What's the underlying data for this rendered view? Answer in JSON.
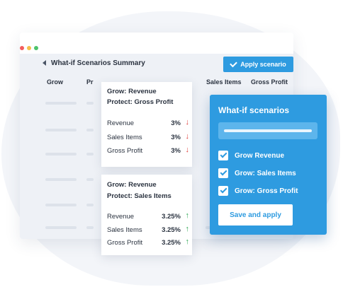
{
  "window": {
    "title": "What-if Scenarios Summary",
    "apply_button": "Apply scenario"
  },
  "table": {
    "columns": [
      "Grow",
      "Pr",
      "Sales Items",
      "Gross Profit"
    ]
  },
  "cards": [
    {
      "grow": "Grow: Revenue",
      "protect": "Protect: Gross Profit",
      "rows": [
        {
          "label": "Revenue",
          "value": "3%",
          "direction": "down"
        },
        {
          "label": "Sales Items",
          "value": "3%",
          "direction": "down"
        },
        {
          "label": "Gross Profit",
          "value": "3%",
          "direction": "down"
        }
      ]
    },
    {
      "grow": "Grow: Revenue",
      "protect": "Protect: Sales Items",
      "rows": [
        {
          "label": "Revenue",
          "value": "3.25%",
          "direction": "up"
        },
        {
          "label": "Sales Items",
          "value": "3.25%",
          "direction": "up"
        },
        {
          "label": "Gross Profit",
          "value": "3.25%",
          "direction": "up"
        }
      ]
    }
  ],
  "arrows": {
    "down": "↓",
    "up": "↑"
  },
  "panel": {
    "title": "What-if scenarios",
    "options": [
      {
        "label": "Grow Revenue",
        "checked": true
      },
      {
        "label": "Grow: Sales Items",
        "checked": true
      },
      {
        "label": "Grow: Gross Profit",
        "checked": true
      }
    ],
    "save_button": "Save and apply"
  },
  "colors": {
    "accent": "#2e9be0",
    "down": "#e0423e",
    "up": "#2fa855"
  }
}
